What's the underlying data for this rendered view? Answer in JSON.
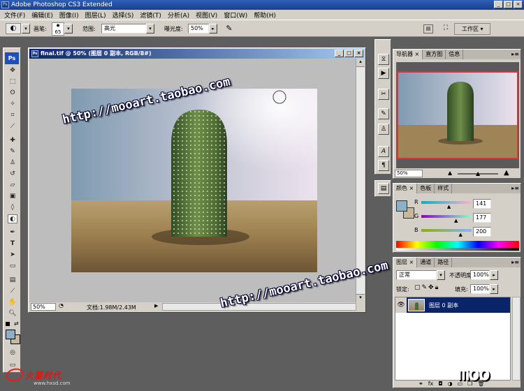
{
  "app": {
    "title": "Adobe Photoshop CS3 Extended",
    "ps_icon": "Ps"
  },
  "window_buttons": [
    "_",
    "□",
    "×"
  ],
  "menu": [
    "文件(F)",
    "编辑(E)",
    "图像(I)",
    "图层(L)",
    "选择(S)",
    "滤镜(T)",
    "分析(A)",
    "视图(V)",
    "窗口(W)",
    "帮助(H)"
  ],
  "options": {
    "brush_label": "画笔:",
    "brush_size": "65",
    "range_label": "范围:",
    "range_value": "高光",
    "exposure_label": "曝光度:",
    "exposure_value": "50%",
    "workspace_label": "工作区"
  },
  "document": {
    "title": "final.tif @ 50% (图层 0 副本, RGB/8#)",
    "zoom": "50%",
    "doc_info": "文档:1.98M/2.43M"
  },
  "navigator": {
    "tabs": [
      "导航器",
      "直方图",
      "信息"
    ],
    "zoom": "50%"
  },
  "color": {
    "tabs": [
      "颜色",
      "色板",
      "样式"
    ],
    "channels": [
      {
        "label": "R",
        "value": "141",
        "level": 0.553
      },
      {
        "label": "G",
        "value": "177",
        "level": 0.694
      },
      {
        "label": "B",
        "value": "200",
        "level": 0.784
      }
    ],
    "foreground": "#8dafc8",
    "background": "#c8b89a"
  },
  "layers": {
    "tabs": [
      "图层",
      "通道",
      "路径"
    ],
    "blend_mode": "正常",
    "opacity_label": "不透明度:",
    "opacity_value": "100%",
    "lock_label": "锁定:",
    "fill_label": "填充:",
    "fill_value": "100%",
    "items": [
      {
        "name": "图层 0 副本",
        "visible": true
      }
    ],
    "footer_icons": [
      "link-icon",
      "fx",
      "mask-icon",
      "adjustment-icon",
      "folder-icon",
      "new-layer-icon",
      "trash-icon"
    ],
    "footer_fx": "fx"
  },
  "watermarks": [
    "http://mooart.taobao.com",
    "http://mooart.taobao.com"
  ],
  "logos": {
    "bottom_left": "火星时代",
    "bottom_left_url": "www.hxsd.com",
    "bottom_right": "moo"
  }
}
